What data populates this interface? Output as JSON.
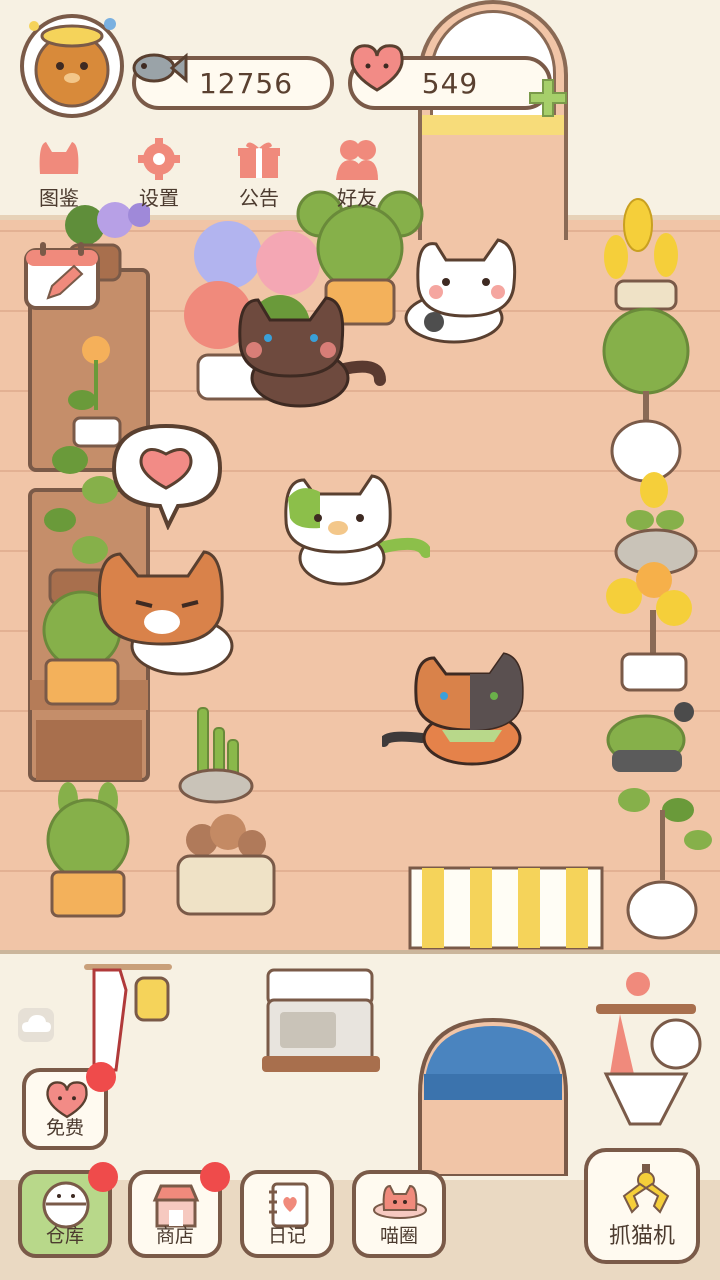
{
  "currency": {
    "fish": "12756",
    "hearts": "549"
  },
  "top_nav": [
    {
      "label": "图鉴",
      "icon": "cat-face-icon"
    },
    {
      "label": "设置",
      "icon": "gear-icon"
    },
    {
      "label": "公告",
      "icon": "gift-icon"
    },
    {
      "label": "好友",
      "icon": "friends-icon"
    }
  ],
  "bottom_nav": {
    "free": "免费",
    "warehouse": "仓库",
    "shop": "商店",
    "diary": "日记",
    "cat_circle": "喵圈",
    "claw_machine": "抓猫机"
  },
  "colors": {
    "accent_green": "#b8d88a",
    "heart_pink": "#f28b86",
    "badge_red": "#ef4b4b",
    "outline_brown": "#7a5a48"
  }
}
